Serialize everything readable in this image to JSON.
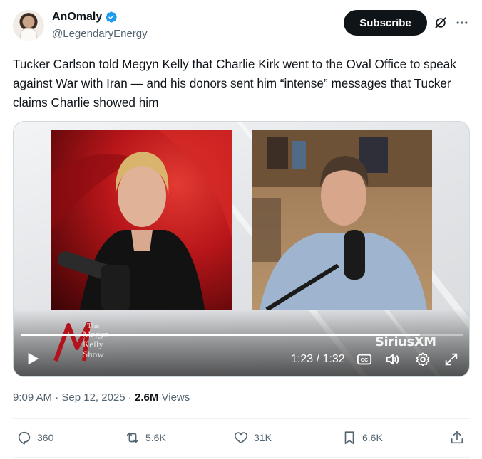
{
  "author": {
    "display_name": "AnOmaly",
    "handle": "@LegendaryEnergy"
  },
  "header": {
    "subscribe_label": "Subscribe"
  },
  "tweet": {
    "text": "Tucker Carlson told Megyn Kelly that Charlie Kirk went to the Oval Office to speak against War with Iran — and his donors sent him “intense” messages that Tucker claims Charlie showed him"
  },
  "video": {
    "show_logo_text": [
      "The",
      "Megyn",
      "Kelly",
      "Show"
    ],
    "watermark": "SiriusXM",
    "time_readout": "1:23 / 1:32",
    "progress_fraction": 0.902
  },
  "meta": {
    "time": "9:09 AM",
    "separator": " · ",
    "date": "Sep 12, 2025",
    "views_count": "2.6M",
    "views_label": "Views"
  },
  "actions": {
    "replies": "360",
    "reposts": "5.6K",
    "likes": "31K",
    "bookmarks": "6.6K"
  },
  "colors": {
    "verified": "#1d9bf0",
    "text_primary": "#0f1419",
    "text_secondary": "#536471",
    "subscribe_bg": "#0f1419"
  },
  "icons": [
    "verified-badge-icon",
    "grok-icon",
    "more-icon",
    "play-icon",
    "captions-icon",
    "volume-icon",
    "settings-icon",
    "fullscreen-icon",
    "reply-icon",
    "repost-icon",
    "like-icon",
    "bookmark-icon",
    "share-icon"
  ]
}
